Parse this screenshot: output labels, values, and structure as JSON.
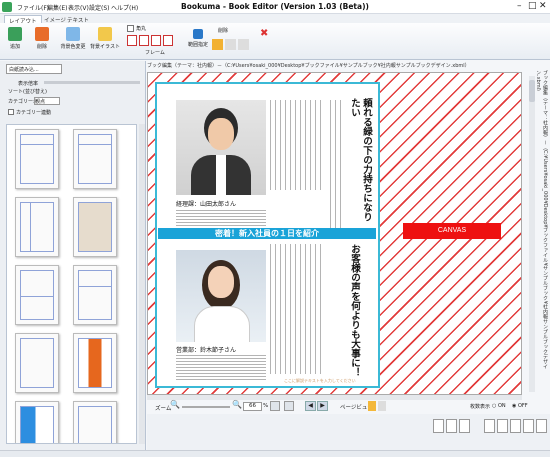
{
  "app": {
    "title": "Bookuma - Book Editor (Version 1.03 (Beta))"
  },
  "menu": [
    "ファイル(F)",
    "編集(E)",
    "表示(V)",
    "設定(S)",
    "ヘルプ(H)"
  ],
  "tabs": [
    "レイアウト",
    "イメージ",
    "テキスト"
  ],
  "ribbon": {
    "add": "追加",
    "delete": "削除",
    "bg_change": "背景色変更",
    "bg_illust": "背景イラスト",
    "corner": "角丸",
    "frame": "フレーム",
    "range": "範囲指定",
    "trash": "削除"
  },
  "left": {
    "blank_button": "白紙読み込...",
    "display_scale": "表示倍率",
    "sort": "ソート(並び替え)",
    "category": "カテゴリー:",
    "category_value": "観点",
    "category_link": "カテゴリー連動"
  },
  "editor": {
    "path": "ブック編集（テーマ：社内報）－（C:¥Users¥osaki_000¥Desktop¥ブックファイル¥サンプルブック¥社内報サンプルブックデザイン.xbml）",
    "vertical_path": "ブック編集（テーマ：社内報）－（C:¥Users¥osaki_000¥Desktop¥ブックファイル¥サンプルブック¥社内報サンプルブックデザイン.xbml）"
  },
  "page": {
    "headline1": "頼れる緑の下の力持ちになりたい",
    "caption1": "経理課：山田太郎さん",
    "banner": "密着！新入社員の１日を紹介",
    "headline2": "お客様の声を何よりも大事に！",
    "caption2": "営業部：鈴木節子さん",
    "footer_note": "ここに解説テキストを入力してください"
  },
  "canvas_label": "CANVAS",
  "zoom": {
    "label": "ズーム",
    "value": "66",
    "unit": "%",
    "page_view": "ページビュー"
  },
  "bottom": {
    "count_display": "枚数表示",
    "on": "ON",
    "off": "OFF"
  },
  "colors": {
    "accent": "#1aa3d8",
    "canvas": "#e11111",
    "stripe": "#e23b3b",
    "page_border": "#3bb9d6"
  }
}
